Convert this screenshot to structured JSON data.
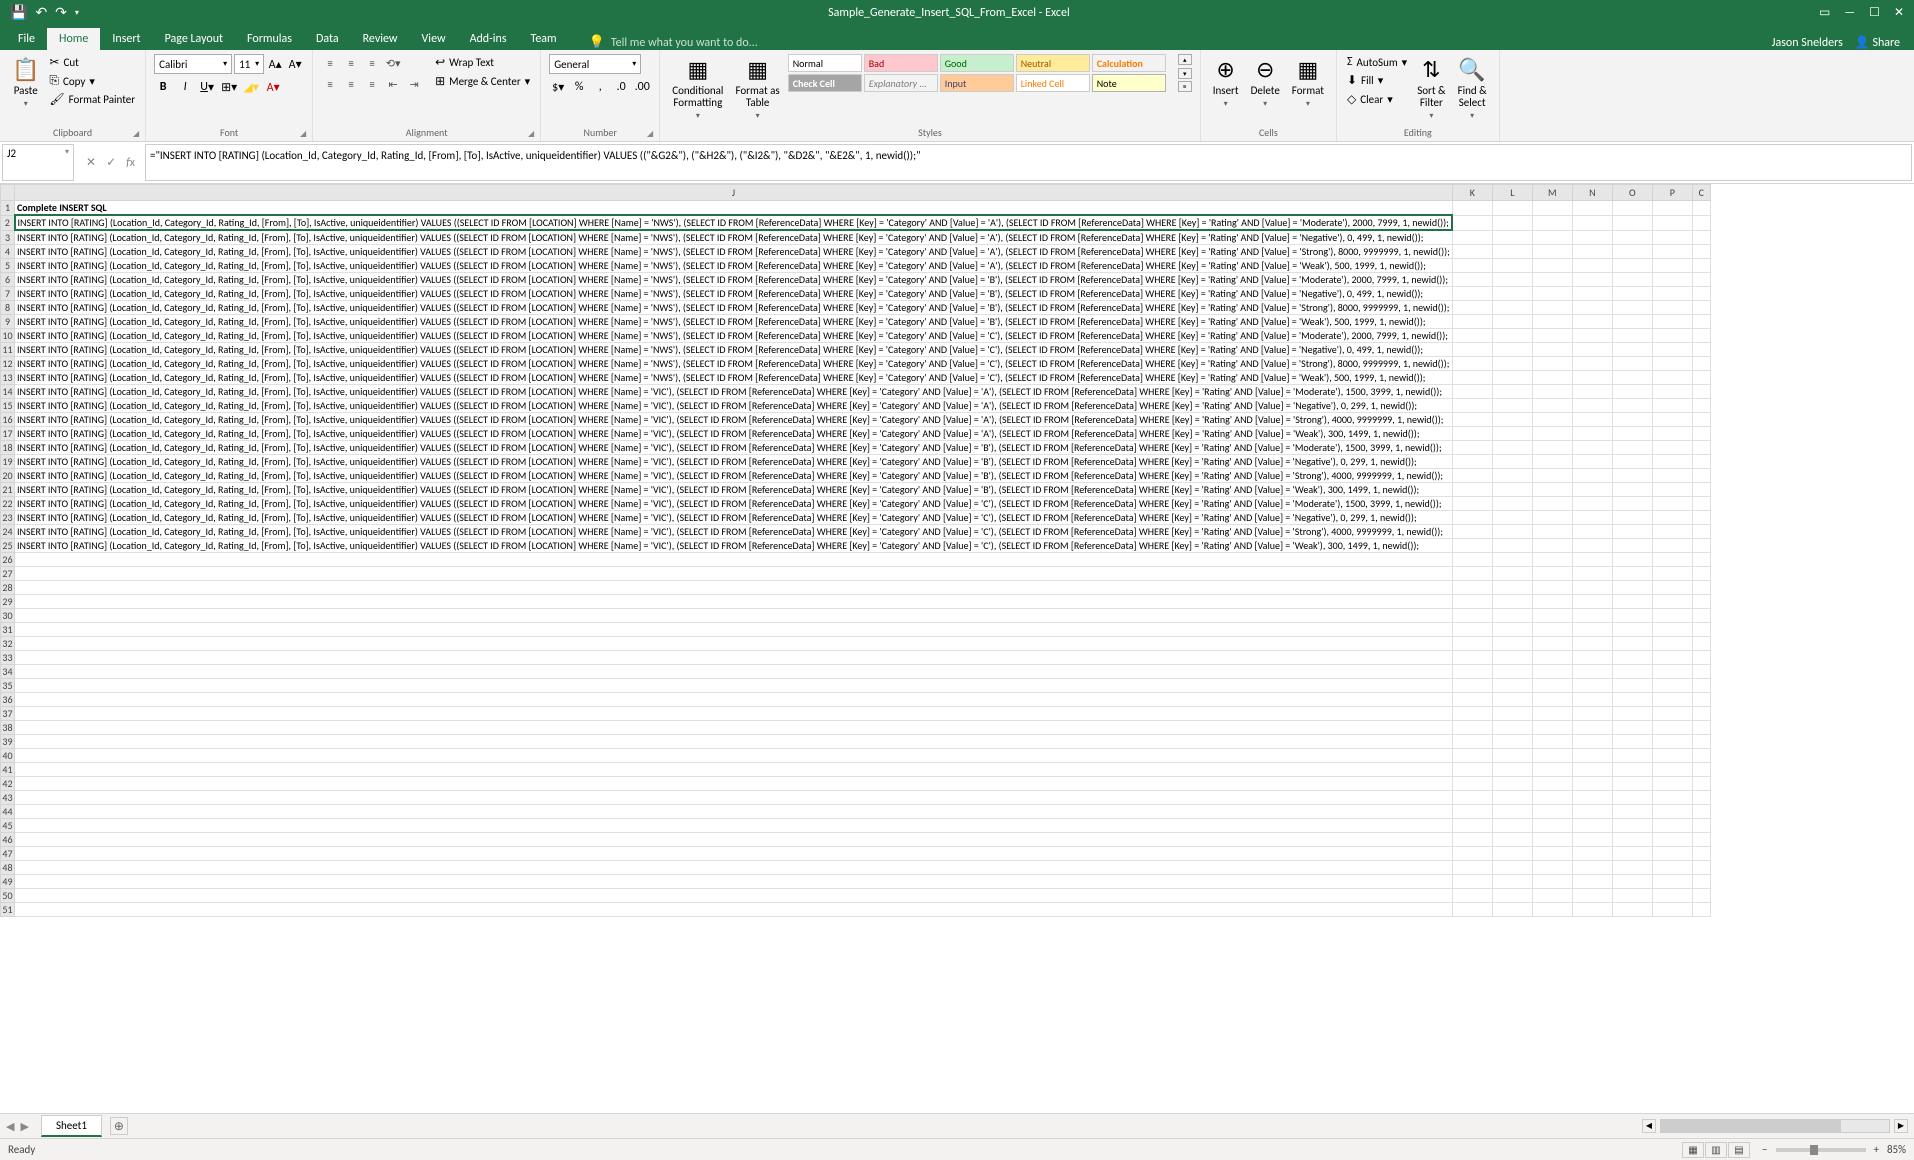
{
  "titleBar": {
    "documentTitle": "Sample_Generate_Insert_SQL_From_Excel - Excel"
  },
  "ribbonTabs": {
    "file": "File",
    "home": "Home",
    "insert": "Insert",
    "pageLayout": "Page Layout",
    "formulas": "Formulas",
    "data": "Data",
    "review": "Review",
    "view": "View",
    "addins": "Add-ins",
    "team": "Team",
    "tellMe": "Tell me what you want to do...",
    "user": "Jason Snelders",
    "share": "Share"
  },
  "ribbon": {
    "clipboard": {
      "label": "Clipboard",
      "paste": "Paste",
      "cut": "Cut",
      "copy": "Copy",
      "formatPainter": "Format Painter"
    },
    "font": {
      "label": "Font",
      "fontName": "Calibri",
      "fontSize": "11"
    },
    "alignment": {
      "label": "Alignment",
      "wrapText": "Wrap Text",
      "mergeCenter": "Merge & Center"
    },
    "number": {
      "label": "Number",
      "format": "General"
    },
    "styles": {
      "label": "Styles",
      "conditional": "Conditional\nFormatting",
      "formatAs": "Format as\nTable",
      "normal": "Normal",
      "bad": "Bad",
      "good": "Good",
      "neutral": "Neutral",
      "calculation": "Calculation",
      "checkCell": "Check Cell",
      "explanatory": "Explanatory ...",
      "input": "Input",
      "linkedCell": "Linked Cell",
      "note": "Note"
    },
    "cells": {
      "label": "Cells",
      "insert": "Insert",
      "delete": "Delete",
      "format": "Format"
    },
    "editing": {
      "label": "Editing",
      "autosum": "AutoSum",
      "fill": "Fill",
      "clear": "Clear",
      "sortFilter": "Sort &\nFilter",
      "findSelect": "Find &\nSelect"
    }
  },
  "formulaBar": {
    "nameBox": "J2",
    "formula": "=\"INSERT INTO [RATING] (Location_Id, Category_Id, Rating_Id, [From], [To], IsActive, uniqueidentifier) VALUES ((\"&G2&\"), (\"&H2&\"), (\"&I2&\"), \"&D2&\", \"&E2&\", 1, newid());\""
  },
  "sheet": {
    "columns": [
      "J",
      "K",
      "L",
      "M",
      "N",
      "O",
      "P",
      "C"
    ],
    "headerRow": {
      "num": "1",
      "value": "Complete INSERT SQL"
    },
    "dataRows": [
      {
        "num": "2",
        "value": "INSERT INTO [RATING] (Location_Id, Category_Id, Rating_Id, [From], [To], IsActive, uniqueidentifier) VALUES ((SELECT ID FROM [LOCATION] WHERE [Name] = 'NWS'), (SELECT ID FROM [ReferenceData] WHERE [Key] = 'Category' AND [Value] = 'A'), (SELECT ID FROM [ReferenceData] WHERE [Key] = 'Rating' AND [Value] = 'Moderate'), 2000, 7999, 1, newid());"
      },
      {
        "num": "3",
        "value": "INSERT INTO [RATING] (Location_Id, Category_Id, Rating_Id, [From], [To], IsActive, uniqueidentifier) VALUES ((SELECT ID FROM [LOCATION] WHERE [Name] = 'NWS'), (SELECT ID FROM [ReferenceData] WHERE [Key] = 'Category' AND [Value] = 'A'), (SELECT ID FROM [ReferenceData] WHERE [Key] = 'Rating' AND [Value] = 'Negative'), 0, 499, 1, newid());"
      },
      {
        "num": "4",
        "value": "INSERT INTO [RATING] (Location_Id, Category_Id, Rating_Id, [From], [To], IsActive, uniqueidentifier) VALUES ((SELECT ID FROM [LOCATION] WHERE [Name] = 'NWS'), (SELECT ID FROM [ReferenceData] WHERE [Key] = 'Category' AND [Value] = 'A'), (SELECT ID FROM [ReferenceData] WHERE [Key] = 'Rating' AND [Value] = 'Strong'), 8000, 9999999, 1, newid());"
      },
      {
        "num": "5",
        "value": "INSERT INTO [RATING] (Location_Id, Category_Id, Rating_Id, [From], [To], IsActive, uniqueidentifier) VALUES ((SELECT ID FROM [LOCATION] WHERE [Name] = 'NWS'), (SELECT ID FROM [ReferenceData] WHERE [Key] = 'Category' AND [Value] = 'A'), (SELECT ID FROM [ReferenceData] WHERE [Key] = 'Rating' AND [Value] = 'Weak'), 500, 1999, 1, newid());"
      },
      {
        "num": "6",
        "value": "INSERT INTO [RATING] (Location_Id, Category_Id, Rating_Id, [From], [To], IsActive, uniqueidentifier) VALUES ((SELECT ID FROM [LOCATION] WHERE [Name] = 'NWS'), (SELECT ID FROM [ReferenceData] WHERE [Key] = 'Category' AND [Value] = 'B'), (SELECT ID FROM [ReferenceData] WHERE [Key] = 'Rating' AND [Value] = 'Moderate'), 2000, 7999, 1, newid());"
      },
      {
        "num": "7",
        "value": "INSERT INTO [RATING] (Location_Id, Category_Id, Rating_Id, [From], [To], IsActive, uniqueidentifier) VALUES ((SELECT ID FROM [LOCATION] WHERE [Name] = 'NWS'), (SELECT ID FROM [ReferenceData] WHERE [Key] = 'Category' AND [Value] = 'B'), (SELECT ID FROM [ReferenceData] WHERE [Key] = 'Rating' AND [Value] = 'Negative'), 0, 499, 1, newid());"
      },
      {
        "num": "8",
        "value": "INSERT INTO [RATING] (Location_Id, Category_Id, Rating_Id, [From], [To], IsActive, uniqueidentifier) VALUES ((SELECT ID FROM [LOCATION] WHERE [Name] = 'NWS'), (SELECT ID FROM [ReferenceData] WHERE [Key] = 'Category' AND [Value] = 'B'), (SELECT ID FROM [ReferenceData] WHERE [Key] = 'Rating' AND [Value] = 'Strong'), 8000, 9999999, 1, newid());"
      },
      {
        "num": "9",
        "value": "INSERT INTO [RATING] (Location_Id, Category_Id, Rating_Id, [From], [To], IsActive, uniqueidentifier) VALUES ((SELECT ID FROM [LOCATION] WHERE [Name] = 'NWS'), (SELECT ID FROM [ReferenceData] WHERE [Key] = 'Category' AND [Value] = 'B'), (SELECT ID FROM [ReferenceData] WHERE [Key] = 'Rating' AND [Value] = 'Weak'), 500, 1999, 1, newid());"
      },
      {
        "num": "10",
        "value": "INSERT INTO [RATING] (Location_Id, Category_Id, Rating_Id, [From], [To], IsActive, uniqueidentifier) VALUES ((SELECT ID FROM [LOCATION] WHERE [Name] = 'NWS'), (SELECT ID FROM [ReferenceData] WHERE [Key] = 'Category' AND [Value] = 'C'), (SELECT ID FROM [ReferenceData] WHERE [Key] = 'Rating' AND [Value] = 'Moderate'), 2000, 7999, 1, newid());"
      },
      {
        "num": "11",
        "value": "INSERT INTO [RATING] (Location_Id, Category_Id, Rating_Id, [From], [To], IsActive, uniqueidentifier) VALUES ((SELECT ID FROM [LOCATION] WHERE [Name] = 'NWS'), (SELECT ID FROM [ReferenceData] WHERE [Key] = 'Category' AND [Value] = 'C'), (SELECT ID FROM [ReferenceData] WHERE [Key] = 'Rating' AND [Value] = 'Negative'), 0, 499, 1, newid());"
      },
      {
        "num": "12",
        "value": "INSERT INTO [RATING] (Location_Id, Category_Id, Rating_Id, [From], [To], IsActive, uniqueidentifier) VALUES ((SELECT ID FROM [LOCATION] WHERE [Name] = 'NWS'), (SELECT ID FROM [ReferenceData] WHERE [Key] = 'Category' AND [Value] = 'C'), (SELECT ID FROM [ReferenceData] WHERE [Key] = 'Rating' AND [Value] = 'Strong'), 8000, 9999999, 1, newid());"
      },
      {
        "num": "13",
        "value": "INSERT INTO [RATING] (Location_Id, Category_Id, Rating_Id, [From], [To], IsActive, uniqueidentifier) VALUES ((SELECT ID FROM [LOCATION] WHERE [Name] = 'NWS'), (SELECT ID FROM [ReferenceData] WHERE [Key] = 'Category' AND [Value] = 'C'), (SELECT ID FROM [ReferenceData] WHERE [Key] = 'Rating' AND [Value] = 'Weak'), 500, 1999, 1, newid());"
      },
      {
        "num": "14",
        "value": "INSERT INTO [RATING] (Location_Id, Category_Id, Rating_Id, [From], [To], IsActive, uniqueidentifier) VALUES ((SELECT ID FROM [LOCATION] WHERE [Name] = 'VIC'), (SELECT ID FROM [ReferenceData] WHERE [Key] = 'Category' AND [Value] = 'A'), (SELECT ID FROM [ReferenceData] WHERE [Key] = 'Rating' AND [Value] = 'Moderate'), 1500, 3999, 1, newid());"
      },
      {
        "num": "15",
        "value": "INSERT INTO [RATING] (Location_Id, Category_Id, Rating_Id, [From], [To], IsActive, uniqueidentifier) VALUES ((SELECT ID FROM [LOCATION] WHERE [Name] = 'VIC'), (SELECT ID FROM [ReferenceData] WHERE [Key] = 'Category' AND [Value] = 'A'), (SELECT ID FROM [ReferenceData] WHERE [Key] = 'Rating' AND [Value] = 'Negative'), 0, 299, 1, newid());"
      },
      {
        "num": "16",
        "value": "INSERT INTO [RATING] (Location_Id, Category_Id, Rating_Id, [From], [To], IsActive, uniqueidentifier) VALUES ((SELECT ID FROM [LOCATION] WHERE [Name] = 'VIC'), (SELECT ID FROM [ReferenceData] WHERE [Key] = 'Category' AND [Value] = 'A'), (SELECT ID FROM [ReferenceData] WHERE [Key] = 'Rating' AND [Value] = 'Strong'), 4000, 9999999, 1, newid());"
      },
      {
        "num": "17",
        "value": "INSERT INTO [RATING] (Location_Id, Category_Id, Rating_Id, [From], [To], IsActive, uniqueidentifier) VALUES ((SELECT ID FROM [LOCATION] WHERE [Name] = 'VIC'), (SELECT ID FROM [ReferenceData] WHERE [Key] = 'Category' AND [Value] = 'A'), (SELECT ID FROM [ReferenceData] WHERE [Key] = 'Rating' AND [Value] = 'Weak'), 300, 1499, 1, newid());"
      },
      {
        "num": "18",
        "value": "INSERT INTO [RATING] (Location_Id, Category_Id, Rating_Id, [From], [To], IsActive, uniqueidentifier) VALUES ((SELECT ID FROM [LOCATION] WHERE [Name] = 'VIC'), (SELECT ID FROM [ReferenceData] WHERE [Key] = 'Category' AND [Value] = 'B'), (SELECT ID FROM [ReferenceData] WHERE [Key] = 'Rating' AND [Value] = 'Moderate'), 1500, 3999, 1, newid());"
      },
      {
        "num": "19",
        "value": "INSERT INTO [RATING] (Location_Id, Category_Id, Rating_Id, [From], [To], IsActive, uniqueidentifier) VALUES ((SELECT ID FROM [LOCATION] WHERE [Name] = 'VIC'), (SELECT ID FROM [ReferenceData] WHERE [Key] = 'Category' AND [Value] = 'B'), (SELECT ID FROM [ReferenceData] WHERE [Key] = 'Rating' AND [Value] = 'Negative'), 0, 299, 1, newid());"
      },
      {
        "num": "20",
        "value": "INSERT INTO [RATING] (Location_Id, Category_Id, Rating_Id, [From], [To], IsActive, uniqueidentifier) VALUES ((SELECT ID FROM [LOCATION] WHERE [Name] = 'VIC'), (SELECT ID FROM [ReferenceData] WHERE [Key] = 'Category' AND [Value] = 'B'), (SELECT ID FROM [ReferenceData] WHERE [Key] = 'Rating' AND [Value] = 'Strong'), 4000, 9999999, 1, newid());"
      },
      {
        "num": "21",
        "value": "INSERT INTO [RATING] (Location_Id, Category_Id, Rating_Id, [From], [To], IsActive, uniqueidentifier) VALUES ((SELECT ID FROM [LOCATION] WHERE [Name] = 'VIC'), (SELECT ID FROM [ReferenceData] WHERE [Key] = 'Category' AND [Value] = 'B'), (SELECT ID FROM [ReferenceData] WHERE [Key] = 'Rating' AND [Value] = 'Weak'), 300, 1499, 1, newid());"
      },
      {
        "num": "22",
        "value": "INSERT INTO [RATING] (Location_Id, Category_Id, Rating_Id, [From], [To], IsActive, uniqueidentifier) VALUES ((SELECT ID FROM [LOCATION] WHERE [Name] = 'VIC'), (SELECT ID FROM [ReferenceData] WHERE [Key] = 'Category' AND [Value] = 'C'), (SELECT ID FROM [ReferenceData] WHERE [Key] = 'Rating' AND [Value] = 'Moderate'), 1500, 3999, 1, newid());"
      },
      {
        "num": "23",
        "value": "INSERT INTO [RATING] (Location_Id, Category_Id, Rating_Id, [From], [To], IsActive, uniqueidentifier) VALUES ((SELECT ID FROM [LOCATION] WHERE [Name] = 'VIC'), (SELECT ID FROM [ReferenceData] WHERE [Key] = 'Category' AND [Value] = 'C'), (SELECT ID FROM [ReferenceData] WHERE [Key] = 'Rating' AND [Value] = 'Negative'), 0, 299, 1, newid());"
      },
      {
        "num": "24",
        "value": "INSERT INTO [RATING] (Location_Id, Category_Id, Rating_Id, [From], [To], IsActive, uniqueidentifier) VALUES ((SELECT ID FROM [LOCATION] WHERE [Name] = 'VIC'), (SELECT ID FROM [ReferenceData] WHERE [Key] = 'Category' AND [Value] = 'C'), (SELECT ID FROM [ReferenceData] WHERE [Key] = 'Rating' AND [Value] = 'Strong'), 4000, 9999999, 1, newid());"
      },
      {
        "num": "25",
        "value": "INSERT INTO [RATING] (Location_Id, Category_Id, Rating_Id, [From], [To], IsActive, uniqueidentifier) VALUES ((SELECT ID FROM [LOCATION] WHERE [Name] = 'VIC'), (SELECT ID FROM [ReferenceData] WHERE [Key] = 'Category' AND [Value] = 'C'), (SELECT ID FROM [ReferenceData] WHERE [Key] = 'Rating' AND [Value] = 'Weak'), 300, 1499, 1, newid());"
      }
    ],
    "emptyRowsStart": 26,
    "emptyRowsEnd": 51
  },
  "sheetTabs": {
    "sheet1": "Sheet1"
  },
  "statusBar": {
    "ready": "Ready",
    "zoom": "85%"
  }
}
